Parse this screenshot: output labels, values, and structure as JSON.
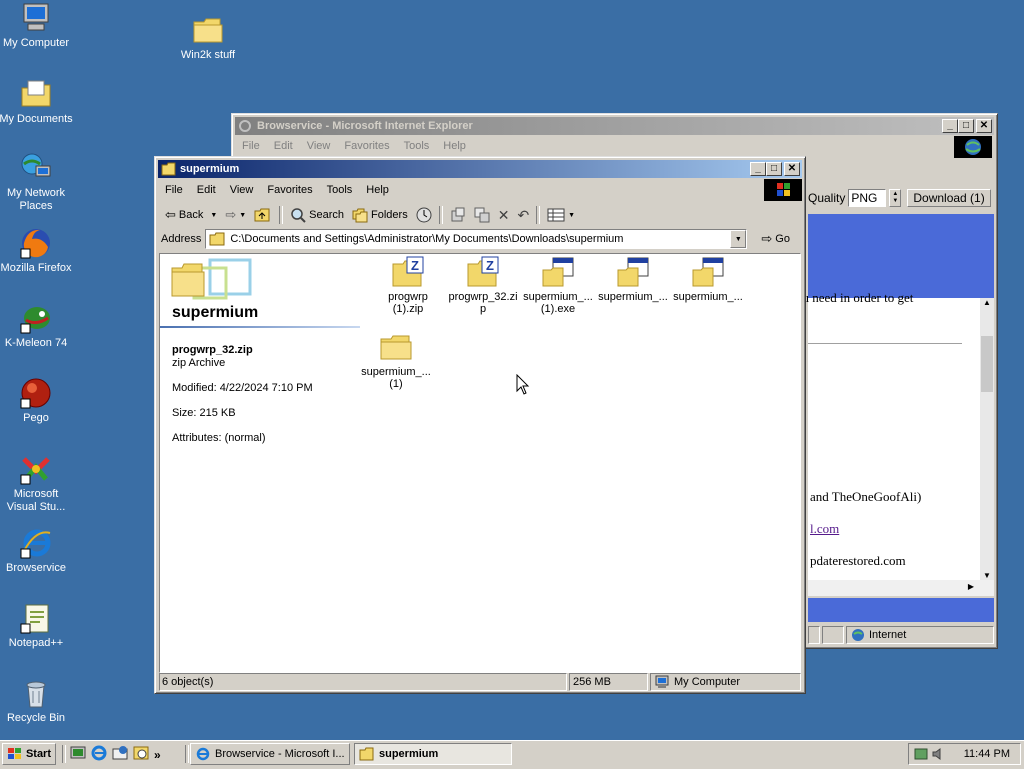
{
  "desktop": {
    "icons": [
      {
        "label": "My Computer",
        "icon": "my-computer-icon"
      },
      {
        "label": "My Documents",
        "icon": "my-documents-icon"
      },
      {
        "label": "My Network Places",
        "icon": "network-places-icon"
      },
      {
        "label": "Mozilla Firefox",
        "icon": "firefox-icon"
      },
      {
        "label": "K-Meleon 74",
        "icon": "k-meleon-icon"
      },
      {
        "label": "Pego",
        "icon": "pego-icon"
      },
      {
        "label": "Microsoft Visual Stu...",
        "icon": "visual-studio-icon"
      },
      {
        "label": "Browservice",
        "icon": "internet-explorer-icon"
      },
      {
        "label": "Notepad++",
        "icon": "notepad-plus-plus-icon"
      },
      {
        "label": "Recycle Bin",
        "icon": "recycle-bin-icon"
      },
      {
        "label": "Win2k stuff",
        "icon": "folder-icon"
      }
    ]
  },
  "ie_window": {
    "title": "Browservice - Microsoft Internet Explorer",
    "menu": [
      "File",
      "Edit",
      "View",
      "Favorites",
      "Tools",
      "Help"
    ],
    "quality_label": "Quality",
    "quality_value": "PNG",
    "download_label": "Download (1)",
    "content_lines": [
      "ou need in order to get",
      "and TheOneGoofAli)",
      "l.com",
      "pdaterestored.com"
    ],
    "status_zone": "Internet"
  },
  "explorer": {
    "title": "supermium",
    "menu": [
      "File",
      "Edit",
      "View",
      "Favorites",
      "Tools",
      "Help"
    ],
    "toolbar": {
      "back": "Back",
      "search": "Search",
      "folders": "Folders"
    },
    "address_label": "Address",
    "address_value": "C:\\Documents and Settings\\Administrator\\My Documents\\Downloads\\supermium",
    "go_label": "Go",
    "panel": {
      "folder_name": "supermium",
      "selected_name": "progwrp_32.zip",
      "selected_type": "zip Archive",
      "modified": "Modified: 4/22/2024 7:10 PM",
      "size": "Size: 215 KB",
      "attributes": "Attributes: (normal)"
    },
    "files": [
      {
        "line1": "progwrp",
        "line2": "(1).zip",
        "icon": "zip-file-icon"
      },
      {
        "line1": "progwrp_32.zi",
        "line2": "p",
        "icon": "zip-file-icon"
      },
      {
        "line1": "supermium_...",
        "line2": "(1).exe",
        "icon": "exe-file-icon"
      },
      {
        "line1": "supermium_...",
        "line2": "",
        "icon": "exe-file-icon"
      },
      {
        "line1": "supermium_...",
        "line2": "",
        "icon": "exe-file-icon"
      },
      {
        "line1": "supermium_...",
        "line2": "(1)",
        "icon": "folder-icon"
      }
    ],
    "status": {
      "objects": "6 object(s)",
      "size": "256 MB",
      "location": "My Computer"
    }
  },
  "taskbar": {
    "start": "Start",
    "tasks": [
      "Browservice - Microsoft I...",
      "supermium"
    ],
    "clock": "11:44 PM"
  },
  "colors": {
    "desktop": "#3a6ea5",
    "title_active": "#0a246a",
    "title_inactive": "#808080",
    "face": "#d4d0c8"
  }
}
